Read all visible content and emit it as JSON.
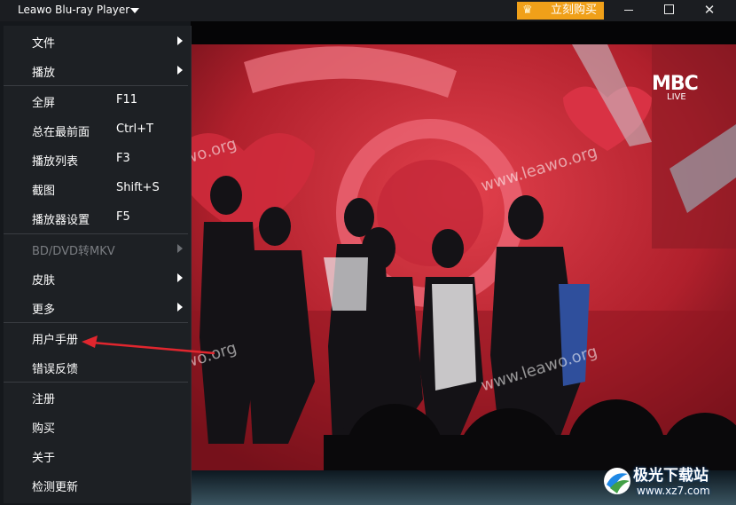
{
  "window": {
    "title": "Leawo Blu-ray Player",
    "buy_label": "立刻购买",
    "crown_glyph": "♛",
    "close_glyph": "✕",
    "accent_color": "#f0a019"
  },
  "menu": {
    "items": [
      {
        "label": "文件",
        "shortcut": "",
        "submenu": true,
        "disabled": false
      },
      {
        "label": "播放",
        "shortcut": "",
        "submenu": true,
        "disabled": false
      },
      {
        "label": "全屏",
        "shortcut": "F11",
        "submenu": false,
        "disabled": false
      },
      {
        "label": "总在最前面",
        "shortcut": "Ctrl+T",
        "submenu": false,
        "disabled": false
      },
      {
        "label": "播放列表",
        "shortcut": "F3",
        "submenu": false,
        "disabled": false
      },
      {
        "label": "截图",
        "shortcut": "Shift+S",
        "submenu": false,
        "disabled": false
      },
      {
        "label": "播放器设置",
        "shortcut": "F5",
        "submenu": false,
        "disabled": false
      },
      {
        "label": "BD/DVD转MKV",
        "shortcut": "",
        "submenu": true,
        "disabled": true
      },
      {
        "label": "皮肤",
        "shortcut": "",
        "submenu": true,
        "disabled": false
      },
      {
        "label": "更多",
        "shortcut": "",
        "submenu": true,
        "disabled": false
      },
      {
        "label": "用户手册",
        "shortcut": "",
        "submenu": false,
        "disabled": false
      },
      {
        "label": "错误反馈",
        "shortcut": "",
        "submenu": false,
        "disabled": false
      },
      {
        "label": "注册",
        "shortcut": "",
        "submenu": false,
        "disabled": false
      },
      {
        "label": "购买",
        "shortcut": "",
        "submenu": false,
        "disabled": false
      },
      {
        "label": "关于",
        "shortcut": "",
        "submenu": false,
        "disabled": false
      },
      {
        "label": "检测更新",
        "shortcut": "",
        "submenu": false,
        "disabled": false
      }
    ]
  },
  "video": {
    "channel_logo": "MBC",
    "channel_live": "LIVE",
    "watermark_1": "www.leawo.org",
    "watermark_2": "wo.org",
    "watermark_3": "www.leawo.org",
    "watermark_4": "wo.org",
    "watermark_5": "www.leawo.org"
  },
  "badge": {
    "name": "极光下载站",
    "url": "www.xz7.com"
  }
}
